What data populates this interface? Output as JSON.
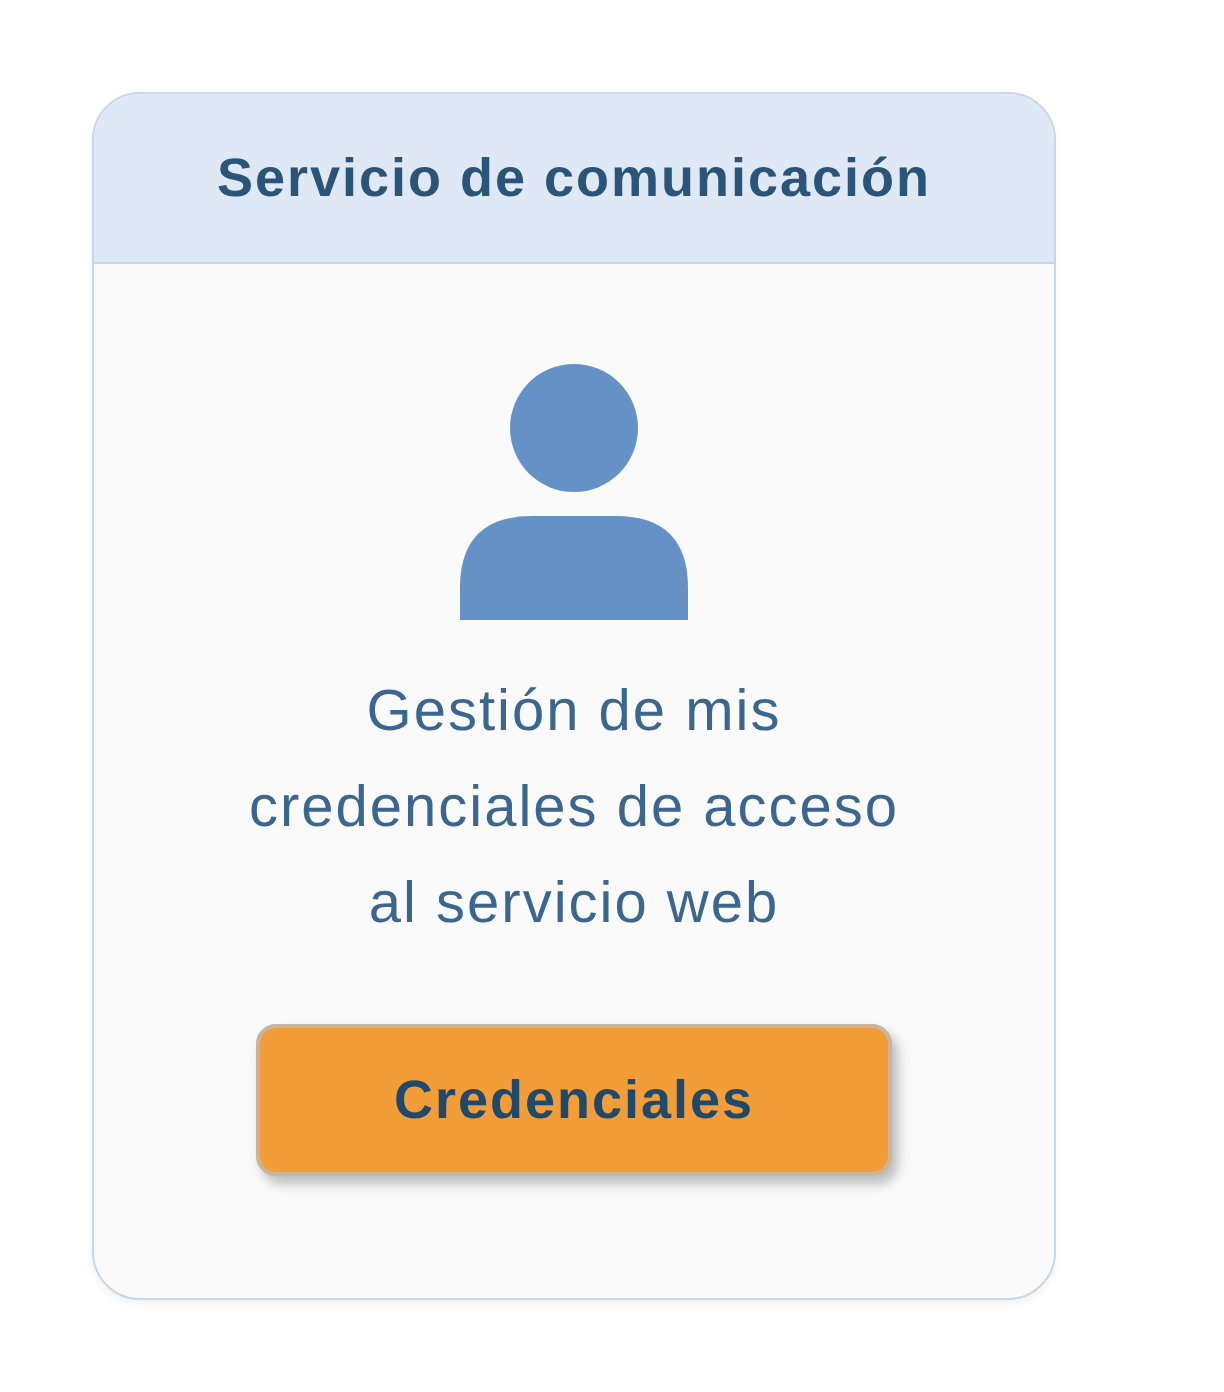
{
  "card": {
    "title": "Servicio de comunicación",
    "description": "Gestión de mis credenciales de acceso al servicio web",
    "button": "Credenciales"
  }
}
